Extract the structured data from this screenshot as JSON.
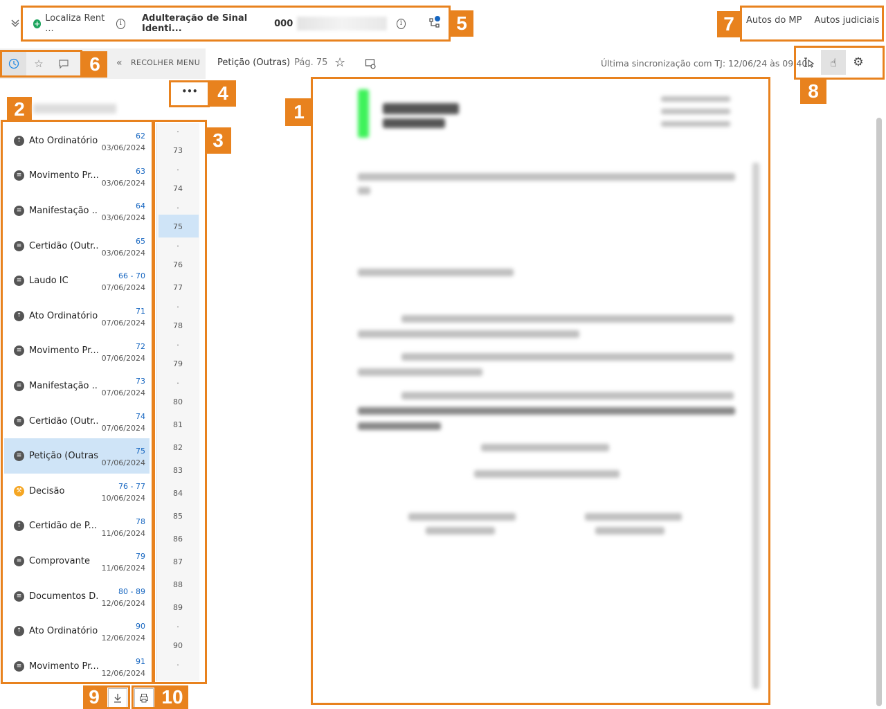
{
  "header": {
    "client": "Localiza Rent ...",
    "crime": "Adulteração de Sinal Identi...",
    "process_number": "000",
    "tabs": [
      "Autos do MP",
      "Autos judiciais"
    ]
  },
  "toolbar": {
    "collapse_menu": "RECOLHER MENU",
    "document_title": "Petição (Outras)",
    "page_label": "Pág. 75",
    "sync_text": "Última sincronização com TJ: 12/06/24 às 09:40"
  },
  "more_button": "•••",
  "documents": [
    {
      "label": "Ato Ordinatório",
      "pages": "62",
      "date": "03/06/2024",
      "icon": "upload-icon"
    },
    {
      "label": "Movimento Pr...",
      "pages": "63",
      "date": "03/06/2024",
      "icon": "document-icon"
    },
    {
      "label": "Manifestação ...",
      "pages": "64",
      "date": "03/06/2024",
      "icon": "document-icon"
    },
    {
      "label": "Certidão (Outr...",
      "pages": "65",
      "date": "03/06/2024",
      "icon": "document-icon"
    },
    {
      "label": "Laudo IC",
      "pages": "66  -  70",
      "date": "07/06/2024",
      "icon": "document-icon"
    },
    {
      "label": "Ato Ordinatório",
      "pages": "71",
      "date": "07/06/2024",
      "icon": "upload-icon"
    },
    {
      "label": "Movimento Pr...",
      "pages": "72",
      "date": "07/06/2024",
      "icon": "document-icon"
    },
    {
      "label": "Manifestação ...",
      "pages": "73",
      "date": "07/06/2024",
      "icon": "document-icon"
    },
    {
      "label": "Certidão (Outr...",
      "pages": "74",
      "date": "07/06/2024",
      "icon": "document-icon"
    },
    {
      "label": "Petição (Outras)",
      "pages": "75",
      "date": "07/06/2024",
      "icon": "document-icon",
      "selected": true
    },
    {
      "label": "Decisão",
      "pages": "76  -  77",
      "date": "10/06/2024",
      "icon": "gavel-icon"
    },
    {
      "label": "Certidão de P...",
      "pages": "78",
      "date": "11/06/2024",
      "icon": "upload-icon"
    },
    {
      "label": "Comprovante",
      "pages": "79",
      "date": "11/06/2024",
      "icon": "document-icon"
    },
    {
      "label": "Documentos D...",
      "pages": "80  -  89",
      "date": "12/06/2024",
      "icon": "document-icon"
    },
    {
      "label": "Ato Ordinatório",
      "pages": "90",
      "date": "12/06/2024",
      "icon": "upload-icon"
    },
    {
      "label": "Movimento Pr...",
      "pages": "91",
      "date": "12/06/2024",
      "icon": "document-icon"
    }
  ],
  "page_numbers": [
    "·",
    "73",
    "·",
    "74",
    "·",
    "75",
    "·",
    "76",
    "77",
    "·",
    "78",
    "·",
    "79",
    "·",
    "80",
    "81",
    "82",
    "83",
    "84",
    "85",
    "86",
    "87",
    "88",
    "89",
    "·",
    "90",
    "·"
  ],
  "selected_page": "75",
  "annotations": [
    "1",
    "2",
    "3",
    "4",
    "5",
    "6",
    "7",
    "8",
    "9",
    "10"
  ],
  "colors": {
    "annotation": "#e8821e",
    "selection": "#cfe4f7",
    "link": "#1565c0"
  }
}
